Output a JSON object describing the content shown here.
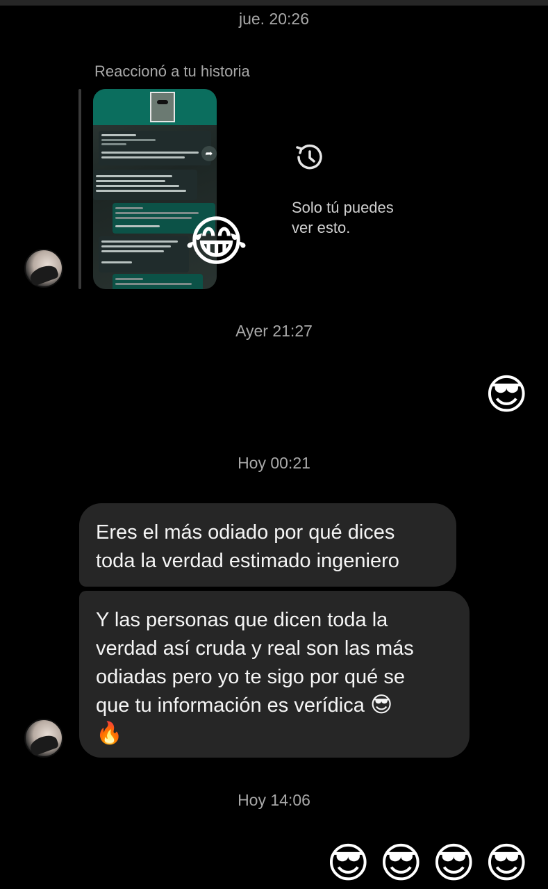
{
  "timestamps": {
    "t1": "jue. 20:26",
    "t2": "Ayer 21:27",
    "t3": "Hoy 00:21",
    "t4": "Hoy 14:06"
  },
  "story_reaction": {
    "label": "Reaccionó a tu historia",
    "reaction_emoji": "😂",
    "thumbnail": {
      "site": "www.adsstars.com",
      "messages": [
        "No no somos una estafa, puedes ingresar a nuestra pagina https://www.adsstars.com/",
        "somos una agencia de marketing de influencers, y estamos trabajando con el proyecto de la plataforma de trading Binomo",
        "Que ingresé tu madre",
        "ok no es necesario ser grosero, feliz tarde",
        "Hasta Luego."
      ]
    }
  },
  "only_you": {
    "icon": "history-icon",
    "text_line1": "Solo tú puedes",
    "text_line2": "ver esto."
  },
  "sent_emoji_1": "😎",
  "received": {
    "message1_line1": "Eres el más odiado por qué dices",
    "message1_line2": "toda la verdad estimado ingeniero",
    "message2_line1": "Y las personas que dicen toda la",
    "message2_line2": "verdad así cruda y real son las más",
    "message2_line3": "odiadas pero yo te sigo por qué se",
    "message2_line4": "que tu información es verídica",
    "message2_emoji1": "😎",
    "message2_emoji2": "🔥"
  },
  "sent_emojis_2": [
    "😎",
    "😎",
    "😎",
    "😎"
  ],
  "colors": {
    "background": "#000000",
    "bubble": "#262626",
    "timestamp": "#a8a8a8"
  }
}
